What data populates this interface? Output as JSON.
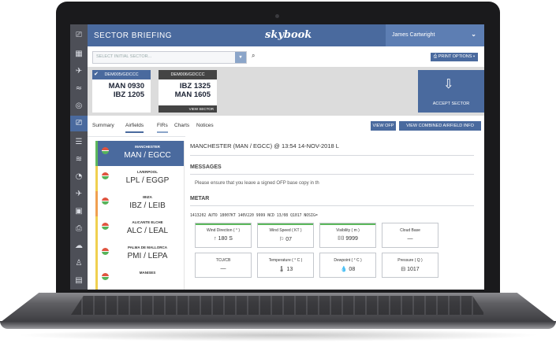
{
  "app": {
    "title": "SECTOR BRIEFING",
    "logo": "skybook",
    "user": "James Cartwright",
    "user_chevron": "⌄"
  },
  "sidebar_icons": [
    "grid-icon",
    "airplane-icon",
    "weather-icon",
    "gauge-icon",
    "briefing-icon",
    "list-icon",
    "wind-icon",
    "clock-icon",
    "plane-out-icon",
    "document-icon",
    "clipboard-icon",
    "cloud-icon",
    "user-icon",
    "file-icon"
  ],
  "sector_select": {
    "placeholder": "SELECT INITIAL SECTOR...",
    "dropdown_glyph": "▾",
    "search_glyph": "⌕",
    "print_label": "⎙ PRINT OPTIONS ▾"
  },
  "sectors": [
    {
      "header": "DEM005/GDCCC",
      "line1": "MAN  0930",
      "line2": "IBZ  1205",
      "check": "✔",
      "footer": ""
    },
    {
      "header": "DEM006/GDCCC",
      "line1": "IBZ  1325",
      "line2": "MAN  1605",
      "check": "",
      "footer": "VIEW SECTOR"
    }
  ],
  "accept_sector": {
    "label": "ACCEPT SECTOR",
    "icon": "⇩"
  },
  "tabs": [
    {
      "label": "Summary",
      "active": false
    },
    {
      "label": "Airfields",
      "active": true
    },
    {
      "label": "FIRs",
      "active": false
    },
    {
      "label": "Charts",
      "active": false
    },
    {
      "label": "Notices",
      "active": false
    }
  ],
  "tab_buttons": {
    "view_ofp": "VIEW OFP",
    "view_combined": "VIEW COMBINED AIRFIELD INFO"
  },
  "airfields": [
    {
      "name": "MANCHESTER",
      "code": "MAN / EGCC",
      "bar": "#5cb85c",
      "active": true
    },
    {
      "name": "LIVERPOOL",
      "code": "LPL / EGGP",
      "bar": "#f0d050",
      "active": false
    },
    {
      "name": "IBIZA",
      "code": "IBZ / LEIB",
      "bar": "#f0a050",
      "active": false
    },
    {
      "name": "ALICANTE ELCHE",
      "code": "ALC / LEAL",
      "bar": "#f0d050",
      "active": false
    },
    {
      "name": "PALMA DE MALLORCA",
      "code": "PMI / LEPA",
      "bar": "#f0d050",
      "active": false
    },
    {
      "name": "MANISES",
      "code": "",
      "bar": "#f0d050",
      "active": false
    }
  ],
  "detail": {
    "heading": "MANCHESTER (MAN / EGCC) @ 13:54 14-NOV-2018 L",
    "messages_title": "MESSAGES",
    "message": "Please ensure that you leave a signed OFP base copy in th",
    "metar_title": "METAR",
    "metar": "1413202 AUTO 18007KT 140V220 9999 NCD 13/08 Q1017 NOSIG="
  },
  "weather_boxes": [
    {
      "label": "Wind Direction ( ° )",
      "value": "↑  180 S",
      "top": true
    },
    {
      "label": "Wind Speed ( KT )",
      "value": "⚐  07",
      "top": true
    },
    {
      "label": "Visibility ( m )",
      "value": "⌷⌷  9999",
      "top": true
    },
    {
      "label": "Cloud Base",
      "value": "—",
      "top": false
    },
    {
      "label": "TCU/CB",
      "value": "—",
      "top": false
    },
    {
      "label": "Temperature ( ° C )",
      "value": "🌡  13",
      "top": false
    },
    {
      "label": "Dewpoint ( ° C )",
      "value": "💧  08",
      "top": false
    },
    {
      "label": "Pressure ( Q )",
      "value": "⊟  1017",
      "top": false
    }
  ],
  "colors": {
    "brand": "#4a6a9e",
    "sidebar": "#4d4f57",
    "good": "#5cb85c"
  }
}
